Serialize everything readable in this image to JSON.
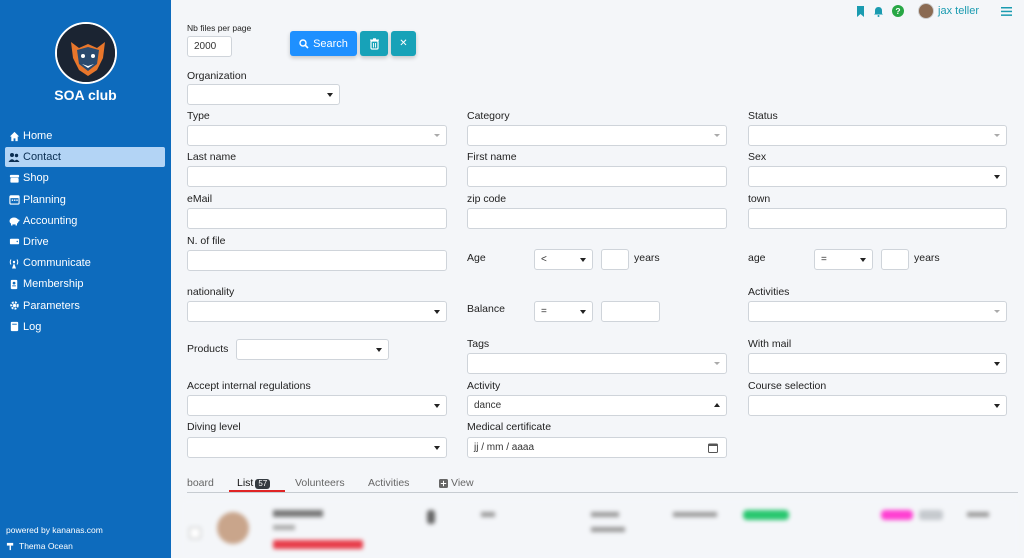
{
  "sidebar": {
    "club_name": "SOA club",
    "items": [
      {
        "label": "Home",
        "icon": "home-icon"
      },
      {
        "label": "Contact",
        "icon": "users-icon",
        "active": true
      },
      {
        "label": "Shop",
        "icon": "shop-icon"
      },
      {
        "label": "Planning",
        "icon": "calendar-icon"
      },
      {
        "label": "Accounting",
        "icon": "piggy-bank-icon"
      },
      {
        "label": "Drive",
        "icon": "drive-icon"
      },
      {
        "label": "Communicate",
        "icon": "broadcast-icon"
      },
      {
        "label": "Membership",
        "icon": "id-card-icon"
      },
      {
        "label": "Parameters",
        "icon": "gear-icon"
      },
      {
        "label": "Log",
        "icon": "book-icon"
      }
    ],
    "powered_by": "powered by kananas.com",
    "theme": "Thema Ocean"
  },
  "topbar": {
    "user_name": "jax teller",
    "help_glyph": "?"
  },
  "toolbar": {
    "nb_files_label": "Nb files per page",
    "nb_files_value": "2000",
    "search_label": "Search",
    "delete_glyph": "🗑",
    "clear_glyph": "✕"
  },
  "filters": {
    "organization": "Organization",
    "type": "Type",
    "category": "Category",
    "status": "Status",
    "last_name": "Last name",
    "first_name": "First name",
    "sex": "Sex",
    "email": "eMail",
    "zip": "zip code",
    "town": "town",
    "n_of_file": "N. of file",
    "age_label": "Age",
    "age_op": "<",
    "years": "years",
    "age2_label": "age",
    "age2_op": "=",
    "nationality": "nationality",
    "balance_label": "Balance",
    "balance_op": "=",
    "activities": "Activities",
    "products": "Products",
    "tags": "Tags",
    "with_mail": "With mail",
    "accept_regulations": "Accept internal regulations",
    "activity": "Activity",
    "activity_value": "dance",
    "course_selection": "Course selection",
    "diving_level": "Diving level",
    "medical_certificate": "Medical certificate",
    "date_placeholder": "jj / mm / aaaa"
  },
  "tabs": {
    "board": "board",
    "list": "List",
    "list_count": "57",
    "volunteers": "Volunteers",
    "activities": "Activities",
    "view": "View"
  },
  "colors": {
    "sidebar_bg": "#0d6bbd",
    "search_btn": "#1e90ff",
    "action_btn": "#17a2b8",
    "accent": "#1a9bb0"
  }
}
